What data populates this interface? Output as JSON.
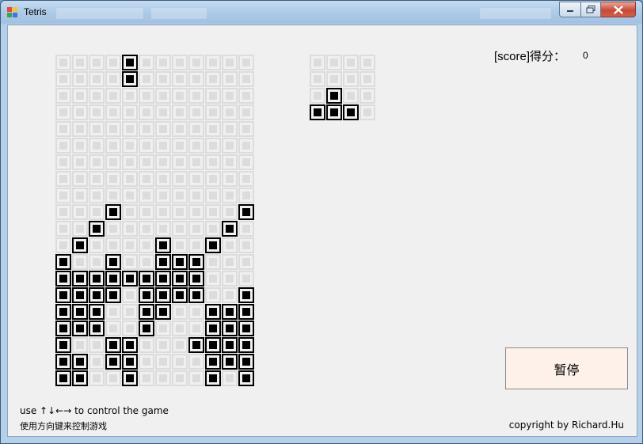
{
  "window": {
    "title": "Tetris",
    "icons": [
      "app-icon",
      "minimize-icon",
      "maximize-icon",
      "close-icon"
    ]
  },
  "score": {
    "label": "[score]得分：",
    "value": "0"
  },
  "pause_button": {
    "label": "暂停"
  },
  "instructions": {
    "english": "use ↑↓←→ to control the game",
    "chinese": "使用方向键来控制游戏"
  },
  "copyright": "copyright by Richard.Hu",
  "colors": {
    "filled": "#000000",
    "empty": "#dcdcdc",
    "background": "#f0f0f0",
    "pause_button_bg": "#fdf1ea"
  },
  "board": {
    "columns": 12,
    "rows": 20,
    "filled": [
      [
        0,
        4
      ],
      [
        1,
        4
      ],
      [
        9,
        3
      ],
      [
        9,
        11
      ],
      [
        10,
        2
      ],
      [
        10,
        10
      ],
      [
        11,
        1
      ],
      [
        11,
        6
      ],
      [
        11,
        9
      ],
      [
        12,
        0
      ],
      [
        12,
        3
      ],
      [
        12,
        6
      ],
      [
        12,
        7
      ],
      [
        12,
        8
      ],
      [
        13,
        0
      ],
      [
        13,
        1
      ],
      [
        13,
        2
      ],
      [
        13,
        3
      ],
      [
        13,
        4
      ],
      [
        13,
        5
      ],
      [
        13,
        6
      ],
      [
        13,
        7
      ],
      [
        13,
        8
      ],
      [
        14,
        0
      ],
      [
        14,
        1
      ],
      [
        14,
        2
      ],
      [
        14,
        3
      ],
      [
        14,
        5
      ],
      [
        14,
        6
      ],
      [
        14,
        7
      ],
      [
        14,
        8
      ],
      [
        14,
        11
      ],
      [
        15,
        0
      ],
      [
        15,
        1
      ],
      [
        15,
        2
      ],
      [
        15,
        5
      ],
      [
        15,
        6
      ],
      [
        15,
        9
      ],
      [
        15,
        10
      ],
      [
        15,
        11
      ],
      [
        16,
        0
      ],
      [
        16,
        1
      ],
      [
        16,
        2
      ],
      [
        16,
        5
      ],
      [
        16,
        9
      ],
      [
        16,
        10
      ],
      [
        16,
        11
      ],
      [
        17,
        0
      ],
      [
        17,
        3
      ],
      [
        17,
        4
      ],
      [
        17,
        8
      ],
      [
        17,
        9
      ],
      [
        17,
        10
      ],
      [
        17,
        11
      ],
      [
        18,
        0
      ],
      [
        18,
        1
      ],
      [
        18,
        3
      ],
      [
        18,
        4
      ],
      [
        18,
        9
      ],
      [
        18,
        10
      ],
      [
        18,
        11
      ],
      [
        19,
        0
      ],
      [
        19,
        1
      ],
      [
        19,
        4
      ],
      [
        19,
        9
      ],
      [
        19,
        11
      ]
    ]
  },
  "next_piece": {
    "columns": 4,
    "rows": 4,
    "filled": [
      [
        2,
        1
      ],
      [
        3,
        0
      ],
      [
        3,
        1
      ],
      [
        3,
        2
      ]
    ]
  }
}
